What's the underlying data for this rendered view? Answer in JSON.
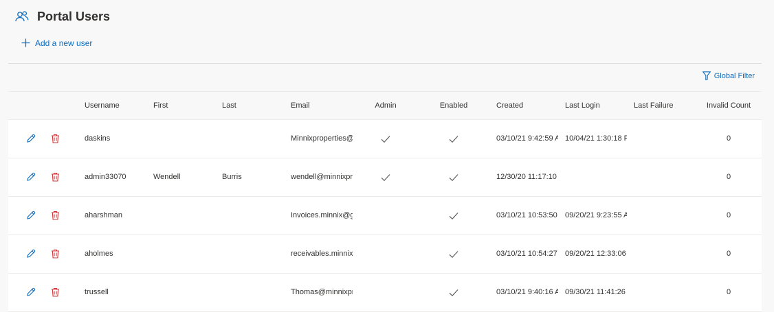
{
  "header": {
    "title": "Portal Users",
    "icon": "users-icon"
  },
  "actions": {
    "add_user_label": "Add a new user",
    "global_filter_label": "Global Filter"
  },
  "colors": {
    "accent": "#0f6cbd",
    "delete": "#d13438",
    "check": "#605e5c"
  },
  "table": {
    "columns": [
      "Username",
      "First",
      "Last",
      "Email",
      "Admin",
      "Enabled",
      "Created",
      "Last Login",
      "Last Failure",
      "Invalid Count"
    ],
    "rows": [
      {
        "username": "daskins",
        "first": "",
        "last": "",
        "email": "Minnixproperties@",
        "admin": true,
        "enabled": true,
        "created": "03/10/21 9:42:59 A",
        "last_login": "10/04/21 1:30:18 F",
        "last_failure": "",
        "invalid_count": "0"
      },
      {
        "username": "admin33070",
        "first": "Wendell",
        "last": "Burris",
        "email": "wendell@minnixpr",
        "admin": true,
        "enabled": true,
        "created": "12/30/20 11:17:10",
        "last_login": "",
        "last_failure": "",
        "invalid_count": "0"
      },
      {
        "username": "aharshman",
        "first": "",
        "last": "",
        "email": "Invoices.minnix@g",
        "admin": false,
        "enabled": true,
        "created": "03/10/21 10:53:50",
        "last_login": "09/20/21 9:23:55 A",
        "last_failure": "",
        "invalid_count": "0"
      },
      {
        "username": "aholmes",
        "first": "",
        "last": "",
        "email": "receivables.minnix",
        "admin": false,
        "enabled": true,
        "created": "03/10/21 10:54:27",
        "last_login": "09/20/21 12:33:06",
        "last_failure": "",
        "invalid_count": "0"
      },
      {
        "username": "trussell",
        "first": "",
        "last": "",
        "email": "Thomas@minnixpr",
        "admin": false,
        "enabled": true,
        "created": "03/10/21 9:40:16 A",
        "last_login": "09/30/21 11:41:26",
        "last_failure": "",
        "invalid_count": "0"
      }
    ]
  }
}
